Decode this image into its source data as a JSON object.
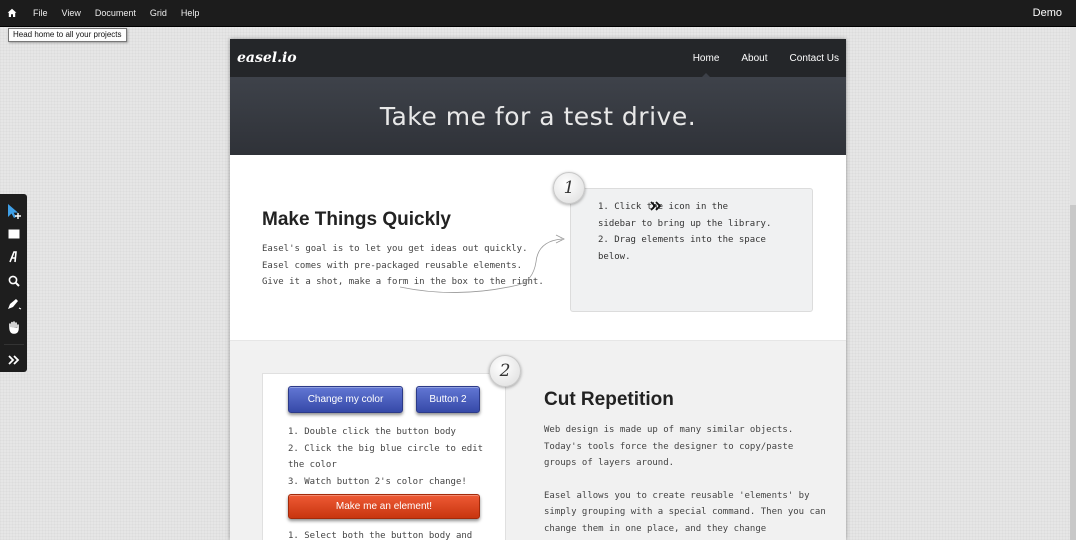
{
  "menubar": {
    "items": [
      "File",
      "View",
      "Document",
      "Grid",
      "Help"
    ],
    "demo_label": "Demo",
    "home_tooltip": "Head home to all your projects"
  },
  "toolbar": {
    "tools": [
      "select-icon",
      "rectangle-icon",
      "text-icon",
      "zoom-icon",
      "pen-icon",
      "hand-icon",
      "expand-icon"
    ]
  },
  "site": {
    "logo": "easel.io",
    "nav": [
      "Home",
      "About",
      "Contact Us"
    ],
    "active_nav": "Home",
    "hero_title": "Take me for a test drive.",
    "section1": {
      "title": "Make Things Quickly",
      "lines": [
        "Easel's goal is to let you get ideas out quickly.",
        "Easel comes with pre-packaged reusable elements.",
        "Give it a shot, make a form in the box to the right."
      ],
      "badge": "1",
      "callout_lines": [
        "1. Click the       icon in the",
        "sidebar to bring up the library.",
        "2. Drag elements into the space",
        "below."
      ]
    },
    "section2": {
      "badge": "2",
      "button_primary": "Change my color",
      "button_secondary": "Button 2",
      "steps_a": [
        "1. Double click the button body",
        "2. Click the big blue circle to edit",
        "the color",
        "3. Watch button 2's color change!"
      ],
      "button_element": "Make me an element!",
      "steps_b": [
        "1. Select both the button body and"
      ],
      "title": "Cut Repetition",
      "paragraph1": [
        "Web design is made up of many similar objects.",
        "Today's tools force the designer to copy/paste",
        "groups of layers around."
      ],
      "paragraph2": [
        "Easel allows you to create reusable 'elements' by",
        "simply grouping with a special command. Then you can",
        "change them in one place, and they change"
      ]
    }
  },
  "colors": {
    "menubar": "#1c1c1c",
    "site_nav": "#242629",
    "hero": "#3a3d44",
    "button_blue": "#4a5ec0",
    "button_red": "#dd4420"
  }
}
